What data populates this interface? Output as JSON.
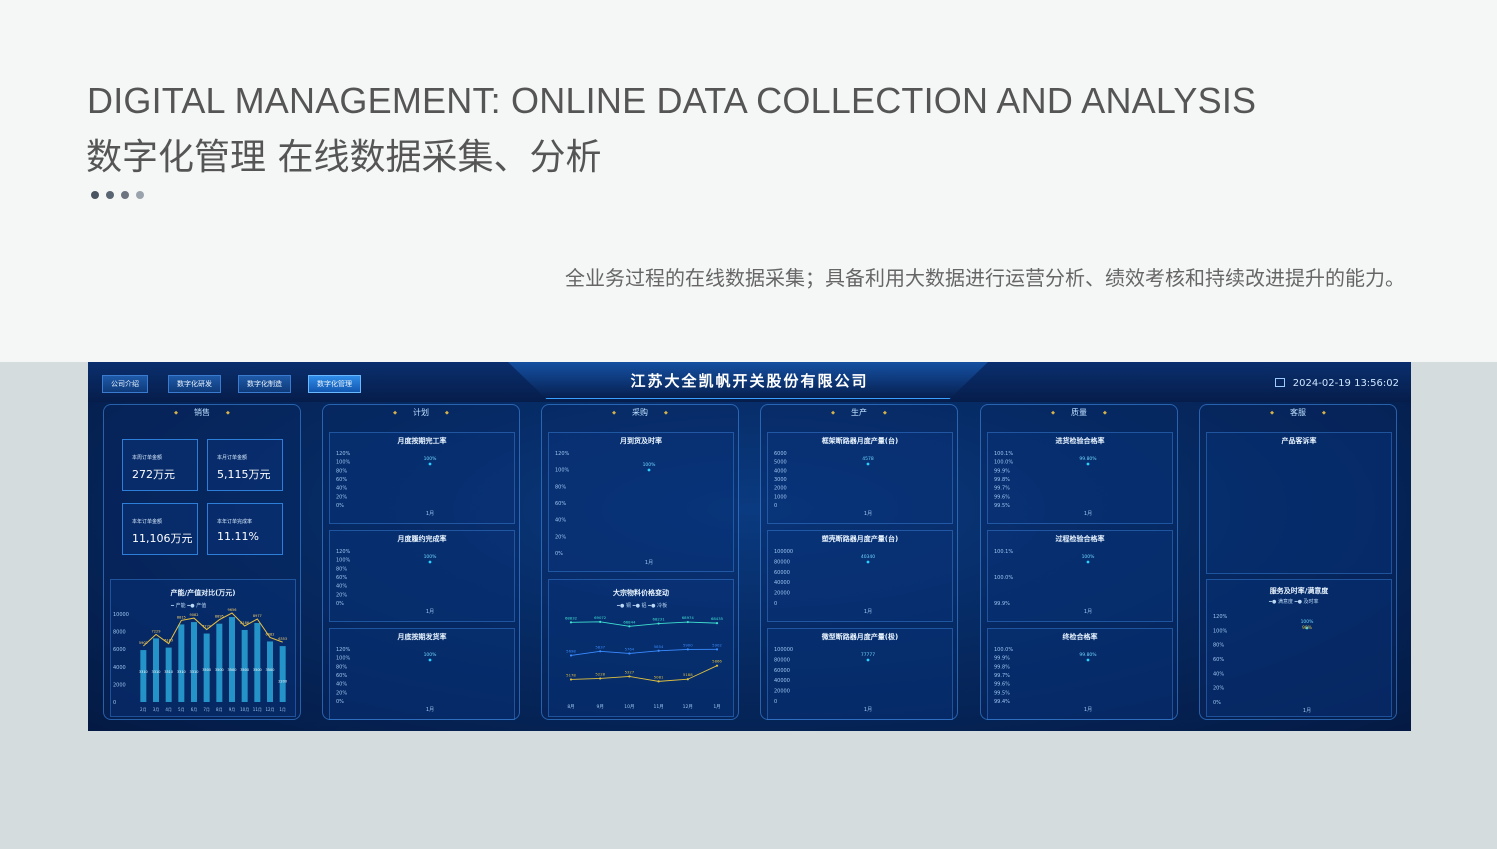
{
  "slide": {
    "title_en": "DIGITAL MANAGEMENT: ONLINE DATA COLLECTION AND ANALYSIS",
    "title_cn": "数字化管理 在线数据采集、分析",
    "subtitle": "全业务过程的在线数据采集；具备利用大数据进行运营分析、绩效考核和持续改进提升的能力。",
    "dot_colors": [
      "#4a5563",
      "#5a6573",
      "#6b7480",
      "#9aa3ad"
    ]
  },
  "dashboard": {
    "company": "江苏大全凯帆开关股份有限公司",
    "datetime": "2024-02-19 13:56:02",
    "nav": [
      "公司介绍",
      "数字化研发",
      "数字化制造",
      "数字化管理"
    ],
    "active_nav": "数字化管理",
    "columns": {
      "sales": {
        "title": "销售",
        "kpis": [
          {
            "label": "本周订单金额",
            "value": "272万元"
          },
          {
            "label": "本月订单金额",
            "value": "5,115万元"
          },
          {
            "label": "本年订单金额",
            "value": "11,106万元"
          },
          {
            "label": "本年订单完成率",
            "value": "11.11%"
          }
        ],
        "chart_title": "产能/产值对比(万元)",
        "legend": [
          "产能",
          "产值"
        ],
        "yticks": [
          "10000",
          "8000",
          "6000",
          "4000",
          "2000",
          "0"
        ],
        "months": [
          "2月",
          "3月",
          "4月",
          "5月",
          "6月",
          "7月",
          "8月",
          "9月",
          "10月",
          "11月",
          "12月",
          "1月"
        ],
        "labels_top": [
          "5902",
          "7229",
          "6183",
          "8815",
          "9082",
          "7779",
          "8895",
          "9656",
          "8186",
          "8977",
          "6882",
          "6353"
        ],
        "labels_mid": [
          "3310",
          "3310",
          "3310",
          "3310",
          "3310",
          "3500",
          "3500",
          "3500",
          "3500",
          "3500",
          "3500",
          "2200"
        ]
      },
      "plan": {
        "title": "计划",
        "panels": [
          {
            "title": "月度按期完工率",
            "value": "100%",
            "month": "1月"
          },
          {
            "title": "月度履约完成率",
            "value": "100%",
            "month": "1月"
          },
          {
            "title": "月底按期发货率",
            "value": "100%",
            "month": "1月"
          }
        ],
        "yticks": [
          "120%",
          "100%",
          "80%",
          "60%",
          "40%",
          "20%",
          "0%"
        ]
      },
      "purchase": {
        "title": "采购",
        "panel_title": "月到货及时率",
        "value": "100%",
        "month": "1月",
        "yticks": [
          "120%",
          "100%",
          "80%",
          "60%",
          "40%",
          "20%",
          "0%"
        ],
        "price_title": "大宗物料价格变动",
        "price_legend": [
          "铜",
          "铝",
          "冷板"
        ],
        "price_months": [
          "8月",
          "9月",
          "10月",
          "11月",
          "12月",
          "1月"
        ],
        "copper": [
          "68832",
          "69072",
          "66844",
          "68231",
          "68974",
          "68435"
        ],
        "aluminum": [
          "5698",
          "5837",
          "5764",
          "5854",
          "5900",
          "5902"
        ],
        "steel": [
          "5178",
          "5228",
          "5327",
          "5081",
          "5188",
          "5866"
        ]
      },
      "production": {
        "title": "生产",
        "panels": [
          {
            "title": "框架断路器月度产量(台)",
            "value": "4578",
            "month": "1月",
            "yticks": [
              "6000",
              "5000",
              "4000",
              "3000",
              "2000",
              "1000",
              "0"
            ]
          },
          {
            "title": "塑壳断路器月度产量(台)",
            "value": "40340",
            "month": "1月",
            "yticks": [
              "100000",
              "80000",
              "60000",
              "40000",
              "20000",
              "0"
            ]
          },
          {
            "title": "微型断路器月度产量(极)",
            "value": "77777",
            "month": "1月",
            "yticks": [
              "100000",
              "80000",
              "60000",
              "40000",
              "20000",
              "0"
            ]
          }
        ]
      },
      "quality": {
        "title": "质量",
        "panels": [
          {
            "title": "进货检验合格率",
            "value": "99.80%",
            "month": "1月",
            "yticks": [
              "100.1%",
              "100.0%",
              "99.9%",
              "99.8%",
              "99.7%",
              "99.6%",
              "99.5%"
            ]
          },
          {
            "title": "过程检验合格率",
            "value": "100%",
            "month": "1月",
            "yticks": [
              "100.1%",
              "100.0%",
              "99.9%"
            ]
          },
          {
            "title": "终检合格率",
            "value": "99.80%",
            "month": "1月",
            "yticks": [
              "100.0%",
              "99.9%",
              "99.8%",
              "99.7%",
              "99.6%",
              "99.5%",
              "99.4%"
            ]
          }
        ]
      },
      "service": {
        "title": "客服",
        "panel_title": "产品客诉率",
        "panel2_title": "服务及时率/满意度",
        "legend": [
          "满意度",
          "及时率"
        ],
        "values": [
          "100%",
          "98%"
        ],
        "month": "1月",
        "yticks": [
          "120%",
          "100%",
          "80%",
          "60%",
          "40%",
          "20%",
          "0%"
        ]
      }
    }
  }
}
